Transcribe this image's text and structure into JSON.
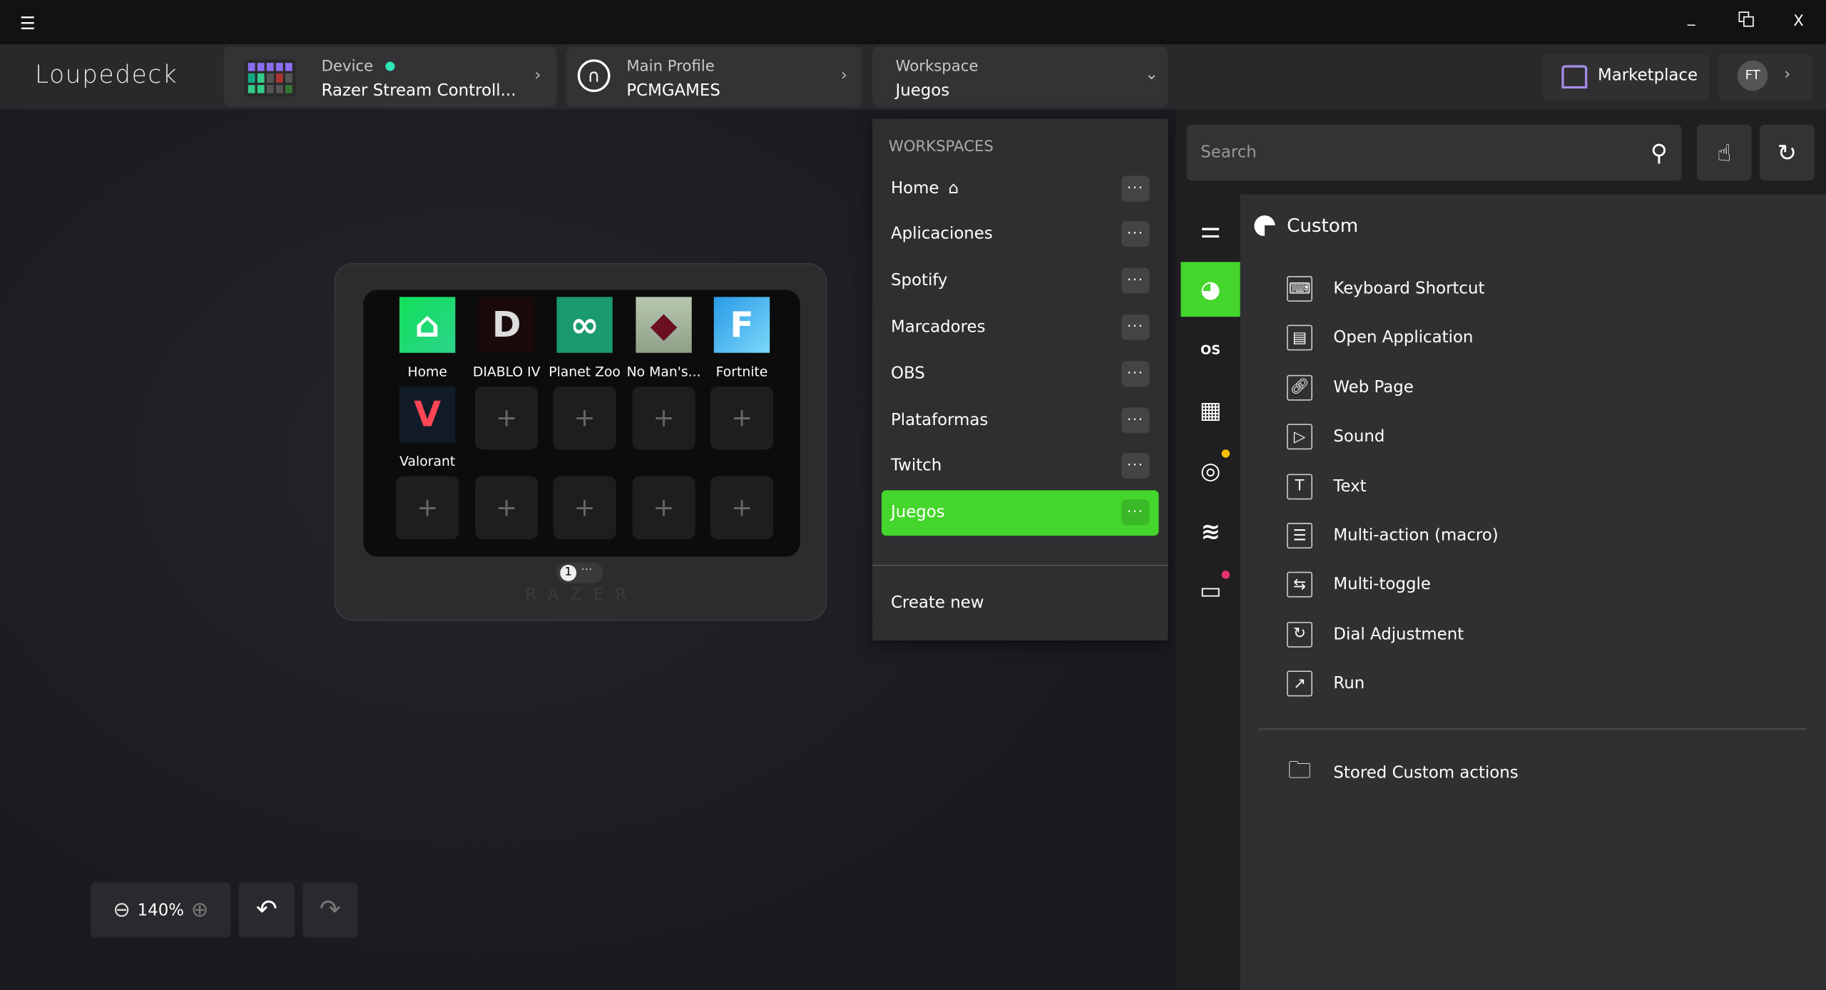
{
  "titlebar": {
    "menu_icon": "hamburger-icon",
    "minimize": "_",
    "restore_icon": "restore-icon",
    "close": "X"
  },
  "header": {
    "logo": "Loupedeck",
    "device": {
      "label": "Device",
      "name": "Razer Stream Controll...",
      "status_color": "#2ee6b5"
    },
    "profile": {
      "label": "Main Profile",
      "name": "PCMGAMES"
    },
    "workspace": {
      "label": "Workspace",
      "name": "Juegos"
    },
    "marketplace": "Marketplace",
    "avatar": "FT"
  },
  "device": {
    "keys": [
      {
        "label": "Home",
        "icon": "home-icon"
      },
      {
        "label": "DIABLO IV",
        "icon": "diablo-icon"
      },
      {
        "label": "Planet Zoo",
        "icon": "planet-zoo-icon"
      },
      {
        "label": "No Man's...",
        "icon": "no-mans-sky-icon"
      },
      {
        "label": "Fortnite",
        "icon": "fortnite-icon"
      },
      {
        "label": "Valorant",
        "icon": "valorant-icon"
      }
    ],
    "empty_key": "+",
    "page": "1",
    "page_more": "···",
    "brand": "RAZER"
  },
  "workspaces": {
    "header": "WORKSPACES",
    "items": [
      {
        "label": "Home"
      },
      {
        "label": "Aplicaciones"
      },
      {
        "label": "Spotify"
      },
      {
        "label": "Marcadores"
      },
      {
        "label": "OBS"
      },
      {
        "label": "Plataformas"
      },
      {
        "label": "Twitch"
      },
      {
        "label": "Juegos",
        "active": true
      }
    ],
    "dots": "···",
    "create_new": "Create new"
  },
  "zoom": {
    "value": "140%"
  },
  "search": {
    "placeholder": "Search"
  },
  "categories": [
    "settings-sliders-icon",
    "custom-icon",
    "os-icon",
    "keyboard-icon",
    "obs-icon",
    "spotify-icon",
    "twitch-icon"
  ],
  "accent": "#44d62c",
  "custom": {
    "title": "Custom",
    "items": [
      {
        "label": "Keyboard Shortcut",
        "icon": "keyboard-icon"
      },
      {
        "label": "Open Application",
        "icon": "application-icon"
      },
      {
        "label": "Web Page",
        "icon": "web-link-icon"
      },
      {
        "label": "Sound",
        "icon": "play-icon"
      },
      {
        "label": "Text",
        "icon": "text-icon"
      },
      {
        "label": "Multi-action (macro)",
        "icon": "multi-action-icon"
      },
      {
        "label": "Multi-toggle",
        "icon": "multi-toggle-icon"
      },
      {
        "label": "Dial Adjustment",
        "icon": "dial-icon"
      },
      {
        "label": "Run",
        "icon": "run-icon"
      }
    ],
    "stored": "Stored Custom actions"
  }
}
